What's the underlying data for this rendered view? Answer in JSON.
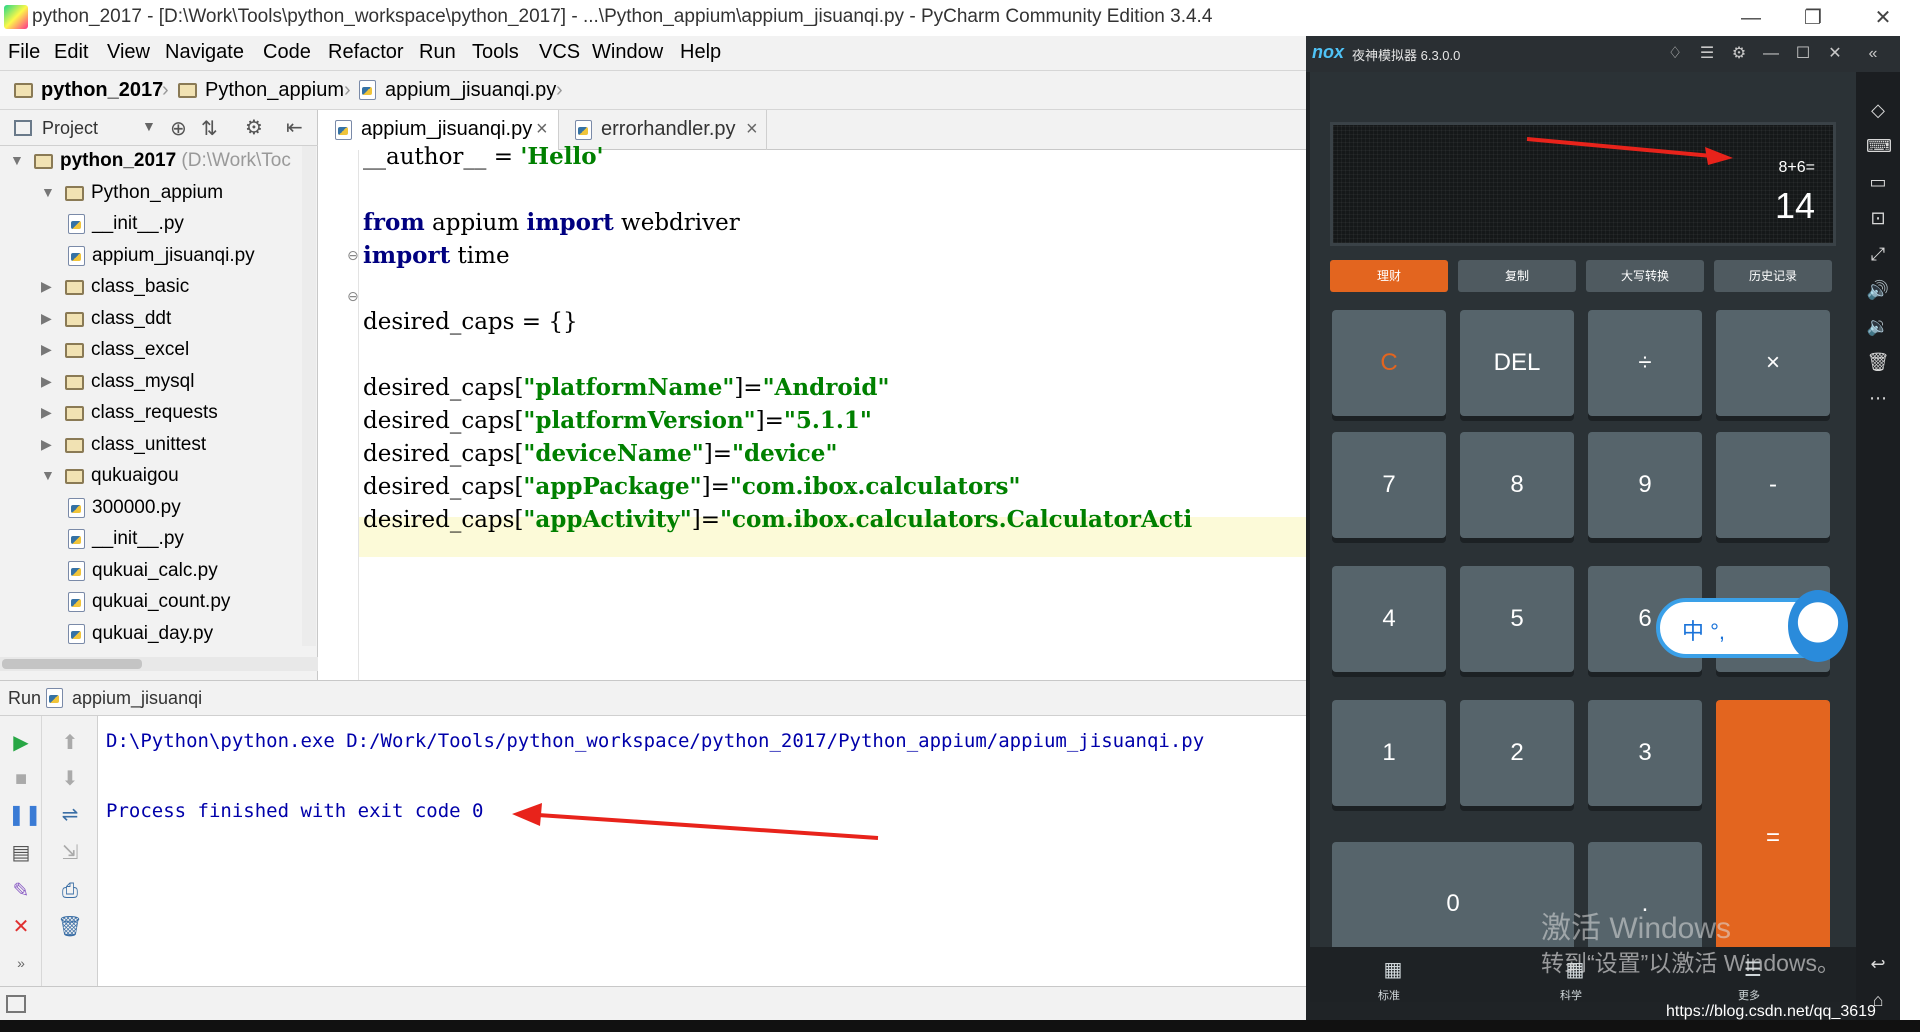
{
  "window": {
    "title": "python_2017 - [D:\\Work\\Tools\\python_workspace\\python_2017] - ...\\Python_appium\\appium_jisuanqi.py - PyCharm Community Edition 3.4.4",
    "controls": {
      "minimize": "—",
      "restore": "❐",
      "close": "✕"
    }
  },
  "menu": [
    "File",
    "Edit",
    "View",
    "Navigate",
    "Code",
    "Refactor",
    "Run",
    "Tools",
    "VCS",
    "Window",
    "Help"
  ],
  "breadcrumb": [
    "python_2017",
    "Python_appium",
    "appium_jisuanqi.py"
  ],
  "project_panel": {
    "title": "Project",
    "tree": [
      {
        "label": "python_2017",
        "suffix": "(D:\\Work\\Toc",
        "type": "folder",
        "depth": 0,
        "expanded": true,
        "bold": true
      },
      {
        "label": "Python_appium",
        "type": "folder",
        "depth": 1,
        "expanded": true
      },
      {
        "label": "__init__.py",
        "type": "py",
        "depth": 2
      },
      {
        "label": "appium_jisuanqi.py",
        "type": "py",
        "depth": 2
      },
      {
        "label": "class_basic",
        "type": "folder",
        "depth": 1,
        "expanded": false
      },
      {
        "label": "class_ddt",
        "type": "folder",
        "depth": 1,
        "expanded": false
      },
      {
        "label": "class_excel",
        "type": "folder",
        "depth": 1,
        "expanded": false
      },
      {
        "label": "class_mysql",
        "type": "folder",
        "depth": 1,
        "expanded": false
      },
      {
        "label": "class_requests",
        "type": "folder",
        "depth": 1,
        "expanded": false
      },
      {
        "label": "class_unittest",
        "type": "folder",
        "depth": 1,
        "expanded": false
      },
      {
        "label": "qukuaigou",
        "type": "folder",
        "depth": 1,
        "expanded": true
      },
      {
        "label": "300000.py",
        "type": "py",
        "depth": 2
      },
      {
        "label": "__init__.py",
        "type": "py",
        "depth": 2
      },
      {
        "label": "qukuai_calc.py",
        "type": "py",
        "depth": 2
      },
      {
        "label": "qukuai_count.py",
        "type": "py",
        "depth": 2
      },
      {
        "label": "qukuai_day.py",
        "type": "py",
        "depth": 2
      }
    ]
  },
  "editor": {
    "tabs": [
      {
        "label": "appium_jisuanqi.py",
        "active": true
      },
      {
        "label": "errorhandler.py",
        "active": false
      }
    ],
    "close_glyph": "×",
    "lines": [
      {
        "parts": [
          {
            "t": "__author__ = ",
            "c": "plain"
          },
          {
            "t": "'Hello'",
            "c": "str"
          }
        ]
      },
      {
        "parts": []
      },
      {
        "parts": [
          {
            "t": "from",
            "c": "kw"
          },
          {
            "t": " appium ",
            "c": "plain"
          },
          {
            "t": "import",
            "c": "kw"
          },
          {
            "t": " webdriver",
            "c": "plain"
          }
        ]
      },
      {
        "parts": [
          {
            "t": "import",
            "c": "kw"
          },
          {
            "t": " time",
            "c": "plain"
          }
        ]
      },
      {
        "parts": []
      },
      {
        "parts": [
          {
            "t": "desired_caps = {}",
            "c": "plain"
          }
        ]
      },
      {
        "parts": []
      },
      {
        "parts": [
          {
            "t": "desired_caps[",
            "c": "plain"
          },
          {
            "t": "\"platformName\"",
            "c": "str"
          },
          {
            "t": "]=",
            "c": "plain"
          },
          {
            "t": "\"Android\"",
            "c": "str"
          }
        ]
      },
      {
        "parts": [
          {
            "t": "desired_caps[",
            "c": "plain"
          },
          {
            "t": "\"platformVersion\"",
            "c": "str"
          },
          {
            "t": "]=",
            "c": "plain"
          },
          {
            "t": "\"5.1.1\"",
            "c": "str"
          }
        ]
      },
      {
        "parts": [
          {
            "t": "desired_caps[",
            "c": "plain"
          },
          {
            "t": "\"deviceName\"",
            "c": "str"
          },
          {
            "t": "]=",
            "c": "plain"
          },
          {
            "t": "\"device\"",
            "c": "str"
          }
        ]
      },
      {
        "parts": [
          {
            "t": "desired_caps[",
            "c": "plain"
          },
          {
            "t": "\"appPackage\"",
            "c": "str"
          },
          {
            "t": "]=",
            "c": "plain"
          },
          {
            "t": "\"com.ibox.calculators\"",
            "c": "str"
          }
        ]
      },
      {
        "parts": [
          {
            "t": "desired_caps[",
            "c": "plain"
          },
          {
            "t": "\"appActivity\"",
            "c": "str"
          },
          {
            "t": "]=",
            "c": "plain"
          },
          {
            "t": "\"com.ibox.calculators.CalculatorActi",
            "c": "str"
          }
        ]
      }
    ]
  },
  "run": {
    "tab_label": "Run",
    "config_name": "appium_jisuanqi",
    "console": [
      "D:\\Python\\python.exe D:/Work/Tools/python_workspace/python_2017/Python_appium/appium_jisuanqi.py",
      "Process finished with exit code 0"
    ]
  },
  "emulator": {
    "logo": "nox",
    "title": "夜神模拟器 6.3.0.0",
    "calculator": {
      "expression": "8+6=",
      "result": "14",
      "function_buttons": [
        "理财",
        "复制",
        "大写转换",
        "历史记录"
      ],
      "keys": [
        {
          "label": "C",
          "color": "#e3651f"
        },
        {
          "label": "DEL"
        },
        {
          "label": "÷"
        },
        {
          "label": "×"
        },
        {
          "label": "7"
        },
        {
          "label": "8"
        },
        {
          "label": "9"
        },
        {
          "label": "-"
        },
        {
          "label": "4"
        },
        {
          "label": "5"
        },
        {
          "label": "6"
        },
        {
          "label": "+"
        },
        {
          "label": "1"
        },
        {
          "label": "2"
        },
        {
          "label": "3"
        },
        {
          "label": "="
        },
        {
          "label": "0"
        },
        {
          "label": "."
        }
      ],
      "ime_text": "中 °, ",
      "bottom_labels": [
        "标准",
        "科学",
        "更多"
      ]
    },
    "sidebar_icons": [
      "screenshot-icon",
      "keyboard-icon",
      "screen-icon",
      "resolution-icon",
      "fullscreen-icon",
      "volume-up-icon",
      "volume-down-icon",
      "trash-icon",
      "more-icon",
      "back-icon",
      "home-icon"
    ]
  },
  "watermark": {
    "line1": "激活 Windows",
    "line2": "转到“设置”以激活 Windows。"
  },
  "csdn_url": "https://blog.csdn.net/qq_3619",
  "colors": {
    "ide_chrome": "#f2f2f2",
    "keyword": "#000080",
    "string": "#008000",
    "console_text": "#0000aa",
    "calc_orange": "#e3651f",
    "calc_key": "#56646b",
    "annotation_red": "#e8231b"
  }
}
